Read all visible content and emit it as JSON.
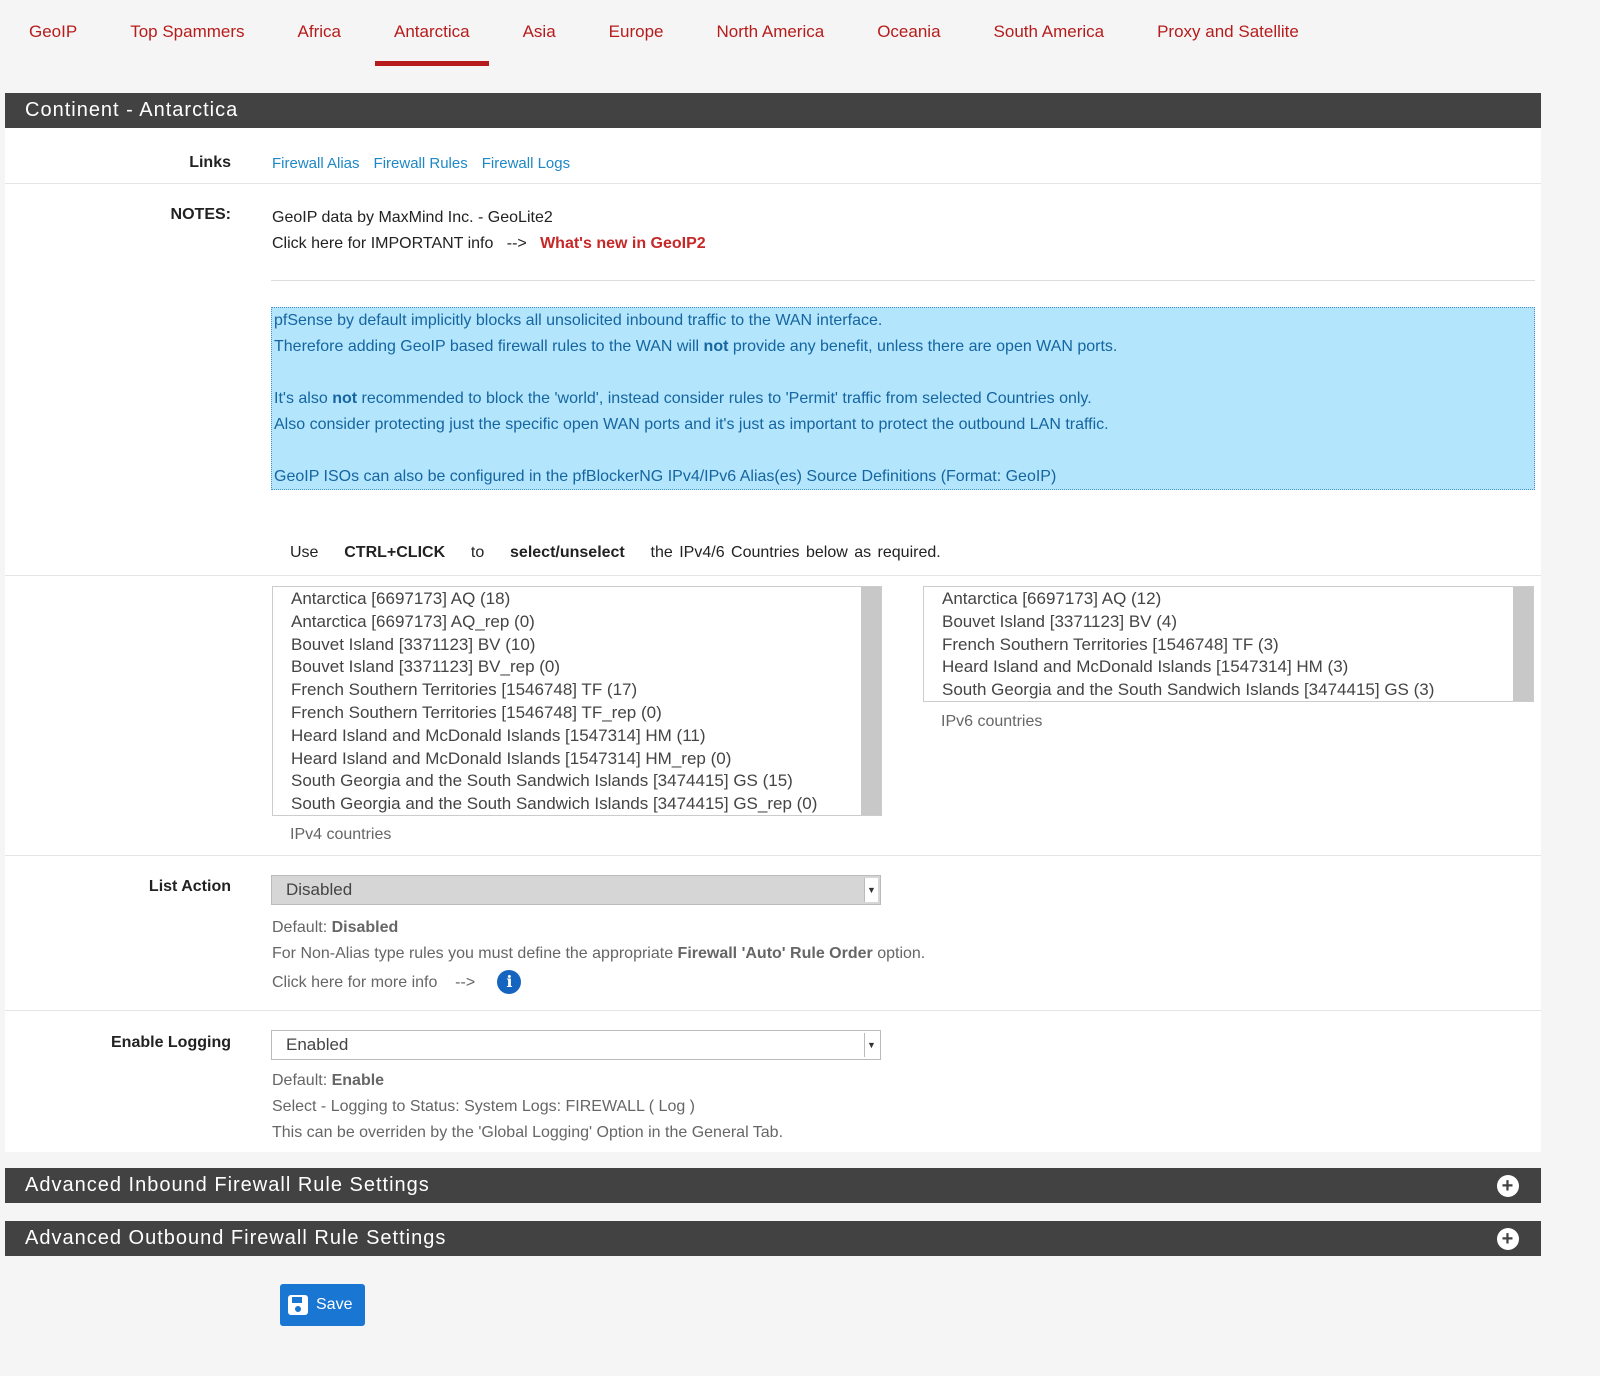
{
  "tabs": [
    "GeoIP",
    "Top Spammers",
    "Africa",
    "Antarctica",
    "Asia",
    "Europe",
    "North America",
    "Oceania",
    "South America",
    "Proxy and Satellite"
  ],
  "active_tab": "Antarctica",
  "panel_title": "Continent - Antarctica",
  "links": {
    "label": "Links",
    "items": [
      "Firewall Alias",
      "Firewall Rules",
      "Firewall Logs"
    ]
  },
  "notes": {
    "label": "NOTES:",
    "line1": "GeoIP data by MaxMind Inc. - GeoLite2",
    "line2": "Click here for IMPORTANT info",
    "arrow": "-->",
    "whats_new": "What's new in GeoIP2"
  },
  "info": {
    "l1": "pfSense by default implicitly blocks all unsolicited inbound traffic to the WAN interface.",
    "l2a": "Therefore adding GeoIP based firewall rules to the WAN will ",
    "l2b": "not",
    "l2c": " provide any benefit, unless there are open WAN ports.",
    "l3a": "It's also ",
    "l3b": "not",
    "l3c": " recommended to block the 'world', instead consider rules to 'Permit' traffic from selected Countries only.",
    "l4": "Also consider protecting just the specific open WAN ports and it's just as important to protect the outbound LAN traffic.",
    "l5": "GeoIP ISOs can also be configured in the pfBlockerNG IPv4/IPv6 Alias(es) Source Definitions (Format: GeoIP)"
  },
  "use": {
    "a": "Use",
    "b": "CTRL+CLICK",
    "c": "to",
    "d": "select/unselect",
    "e": "the IPv4/6 Countries below as required."
  },
  "ipv4": {
    "label": "IPv4 countries",
    "items": [
      "Antarctica [6697173] AQ (18)",
      "Antarctica [6697173] AQ_rep (0)",
      "Bouvet Island [3371123] BV (10)",
      "Bouvet Island [3371123] BV_rep (0)",
      "French Southern Territories [1546748] TF (17)",
      "French Southern Territories [1546748] TF_rep (0)",
      "Heard Island and McDonald Islands [1547314] HM (11)",
      "Heard Island and McDonald Islands [1547314] HM_rep (0)",
      "South Georgia and the South Sandwich Islands [3474415] GS (15)",
      "South Georgia and the South Sandwich Islands [3474415] GS_rep (0)"
    ]
  },
  "ipv6": {
    "label": "IPv6 countries",
    "items": [
      "Antarctica [6697173] AQ (12)",
      "Bouvet Island [3371123] BV (4)",
      "French Southern Territories [1546748] TF (3)",
      "Heard Island and McDonald Islands [1547314] HM (3)",
      "South Georgia and the South Sandwich Islands [3474415] GS (3)"
    ]
  },
  "list_action": {
    "label": "List Action",
    "value": "Disabled",
    "default_label": "Default: ",
    "default_value": "Disabled",
    "help_a": "For Non-Alias type rules you must define the appropriate ",
    "help_b": "Firewall 'Auto' Rule Order",
    "help_c": " option.",
    "more": "Click here for more info",
    "arrow": "-->"
  },
  "logging": {
    "label": "Enable Logging",
    "value": "Enabled",
    "default_label": "Default: ",
    "default_value": "Enable",
    "help1": "Select - Logging to Status: System Logs: FIREWALL ( Log )",
    "help2": "This can be overriden by the 'Global Logging' Option in the General Tab."
  },
  "adv_inbound": "Advanced Inbound Firewall Rule Settings",
  "adv_outbound": "Advanced Outbound Firewall Rule Settings",
  "save": "Save",
  "colors": {
    "accent": "#b71c1c",
    "header": "#424242",
    "info_bg": "#b3e5fc",
    "save": "#1976d2"
  }
}
